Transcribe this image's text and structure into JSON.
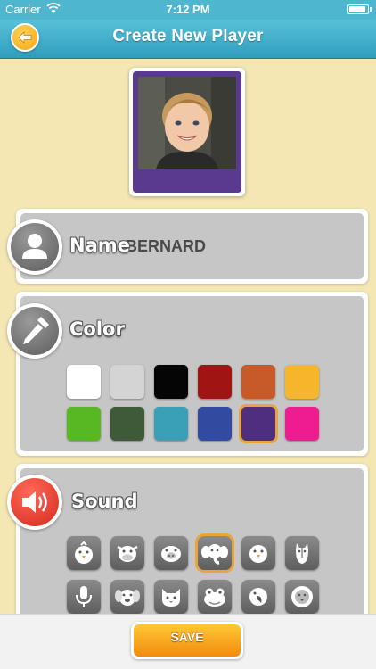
{
  "status_bar": {
    "carrier": "Carrier",
    "time": "7:12 PM",
    "battery_level": 0.95
  },
  "nav": {
    "title": "Create New Player",
    "back_icon": "arrow-left-icon"
  },
  "player": {
    "photo": "child-portrait-photo",
    "card_color": "#5a3a8e"
  },
  "name_section": {
    "label": "Name",
    "value": "BERNARD",
    "icon": "person-icon"
  },
  "color_section": {
    "label": "Color",
    "icon": "eyedropper-icon",
    "swatches": [
      "#ffffff",
      "#d4d4d4",
      "#050505",
      "#a11414",
      "#c85a2a",
      "#f7b52c",
      "#58b824",
      "#3f5a38",
      "#3aa0b8",
      "#324aa0",
      "#4f2e80",
      "#ee1c8e"
    ],
    "selected_index": 10
  },
  "sound_section": {
    "label": "Sound",
    "icon": "speaker-icon",
    "sounds": [
      "chick-icon",
      "cow-icon",
      "pig-icon",
      "elephant-icon",
      "bird-icon",
      "horse-icon",
      "microphone-icon",
      "dog-icon",
      "cat-icon",
      "frog-icon",
      "parrot-icon",
      "lion-icon"
    ],
    "selected_index": 3
  },
  "footer": {
    "save_label": "SAVE"
  }
}
